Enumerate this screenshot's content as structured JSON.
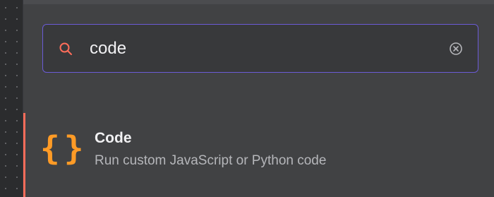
{
  "search": {
    "value": "code",
    "icon": "search-icon",
    "clear_icon": "clear-circle-x-icon"
  },
  "results": [
    {
      "icon": "code-braces-icon",
      "icon_glyph": "{}",
      "title": "Code",
      "description": "Run custom JavaScript or Python code"
    }
  ],
  "colors": {
    "accent": "#ff6d5a",
    "focus_border": "#6b5bd6",
    "braces": "#ff9b26"
  }
}
